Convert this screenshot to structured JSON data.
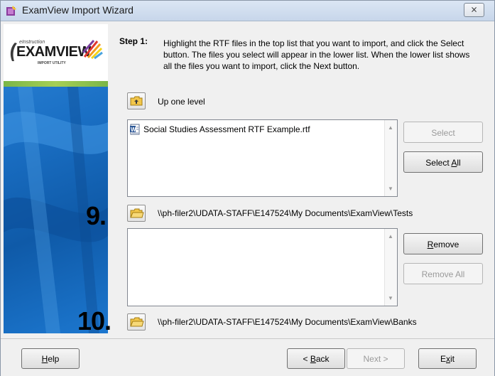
{
  "window": {
    "title": "ExamView Import Wizard",
    "close_label": "⨯"
  },
  "logo": {
    "top": "eInstruction",
    "name": "EXAMVIEW",
    "sub": "IMPORT UTILITY"
  },
  "step": {
    "label": "Step 1:",
    "instructions": "Highlight the RTF files in the top list that you want to import, and click the Select button.  The files you select will appear in the lower list.  When the lower list shows all the files you want to import, click the Next button."
  },
  "up_one_level": {
    "label": "Up one level",
    "icon": "folder-up-icon"
  },
  "source_list": {
    "items": [
      {
        "name": "Social Studies Assessment RTF Example.rtf",
        "icon": "word-document-icon"
      }
    ]
  },
  "buttons": {
    "select": {
      "label": "Select",
      "enabled": false
    },
    "select_all": {
      "pre": "Select ",
      "key": "A",
      "post": "ll",
      "enabled": true
    },
    "remove": {
      "key": "R",
      "post": "emove",
      "enabled": true
    },
    "remove_all": {
      "label": "Remove All",
      "enabled": false
    },
    "help": {
      "key": "H",
      "post": "elp"
    },
    "back": {
      "pre": "< ",
      "key": "B",
      "post": "ack"
    },
    "next": {
      "label": "Next >",
      "enabled": false
    },
    "exit": {
      "pre": "E",
      "key": "x",
      "post": "it"
    }
  },
  "paths": {
    "tests": "\\\\ph-filer2\\UDATA-STAFF\\E147524\\My Documents\\ExamView\\Tests",
    "banks": "\\\\ph-filer2\\UDATA-STAFF\\E147524\\My Documents\\ExamView\\Banks"
  },
  "annotations": {
    "nine": "9.",
    "ten": "10."
  },
  "colors": {
    "sidebar_blue": "#1a6fc4",
    "logo_stripe": "#7ab648"
  }
}
